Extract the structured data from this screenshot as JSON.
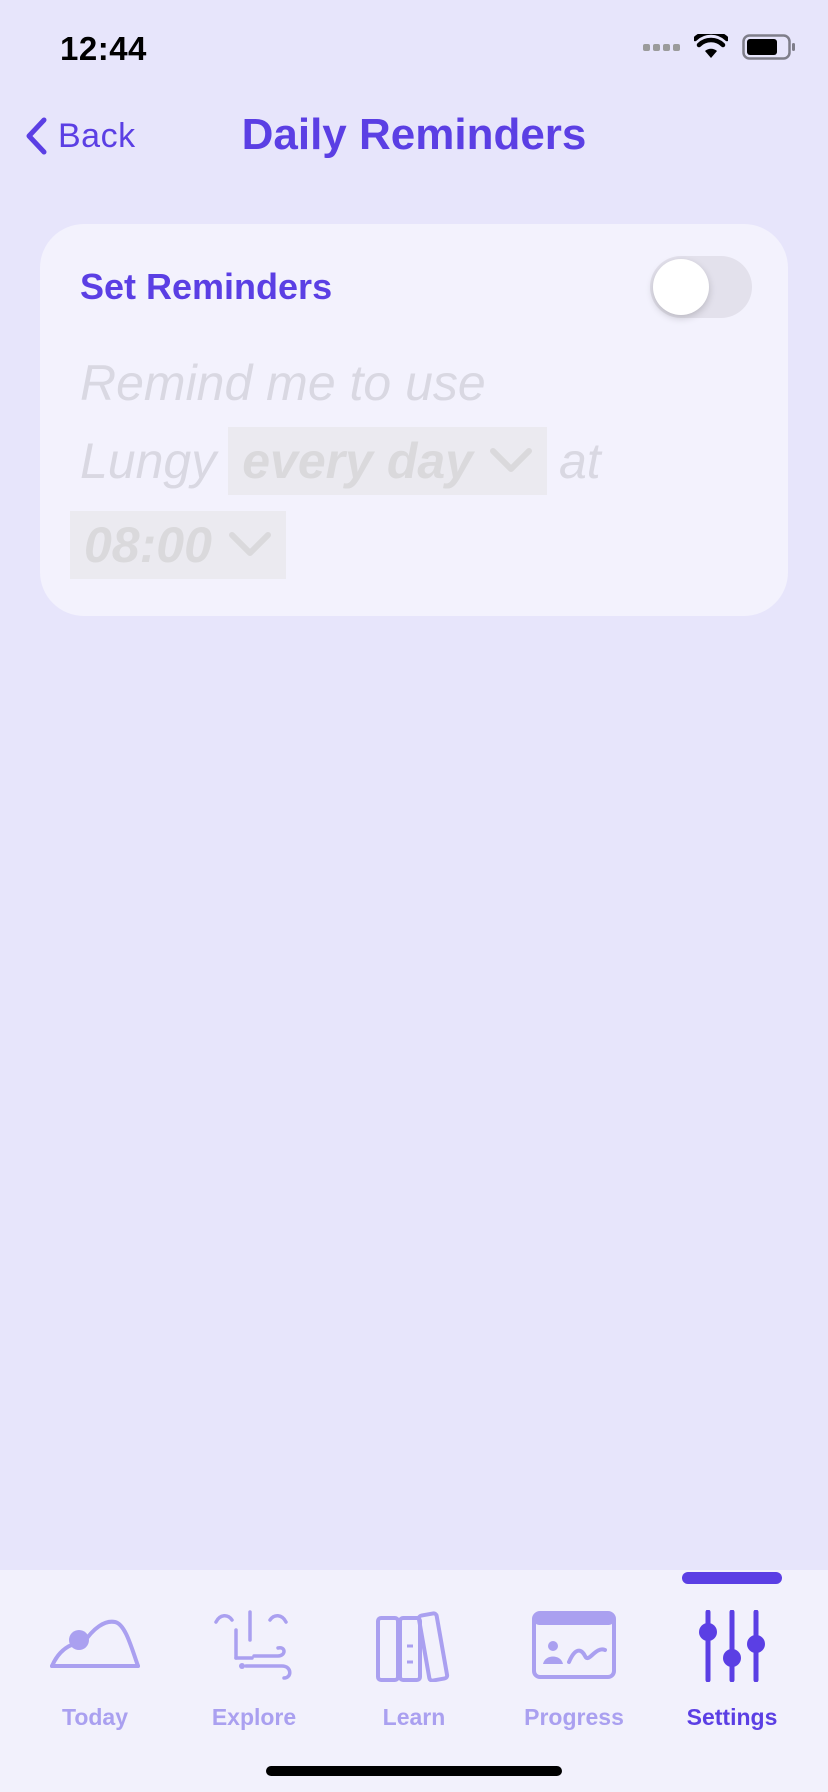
{
  "status_bar": {
    "time": "12:44"
  },
  "nav": {
    "back_label": "Back",
    "title": "Daily Reminders"
  },
  "card": {
    "heading": "Set Reminders",
    "toggle_on": false,
    "line1": "Remind me to use",
    "line2_prefix": "Lungy",
    "frequency": "every day",
    "line2_suffix": "at",
    "time": "08:00"
  },
  "tabs": [
    {
      "label": "Today",
      "icon": "today-icon"
    },
    {
      "label": "Explore",
      "icon": "explore-icon"
    },
    {
      "label": "Learn",
      "icon": "books-icon"
    },
    {
      "label": "Progress",
      "icon": "progress-icon"
    },
    {
      "label": "Settings",
      "icon": "sliders-icon"
    }
  ],
  "active_tab": "Settings",
  "colors": {
    "accent": "#5b3fe4",
    "tab_inactive": "#aaa0f0",
    "background": "#e7e5fb",
    "card": "#f3f2fd"
  }
}
